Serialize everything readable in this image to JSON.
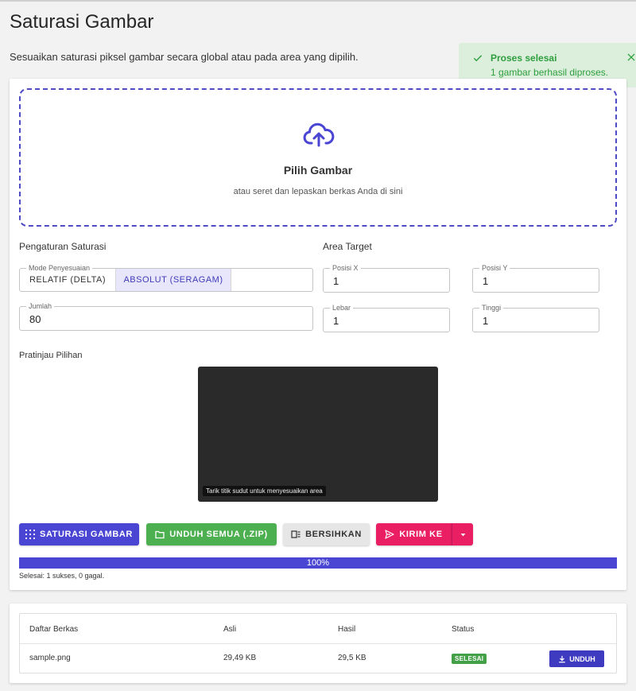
{
  "page": {
    "title": "Saturasi Gambar",
    "description": "Sesuaikan saturasi piksel gambar secara global atau pada area yang dipilih."
  },
  "toast": {
    "title": "Proses selesai",
    "message": "1 gambar berhasil diproses.",
    "color": "#2e9e3e",
    "icons": [
      "check-icon",
      "close-icon"
    ]
  },
  "dropzone": {
    "title": "Pilih Gambar",
    "subtitle": "atau seret dan lepaskan berkas Anda di sini",
    "icon": "cloud-upload-icon",
    "accent": "#4f4bc4"
  },
  "saturation": {
    "section_label": "Pengaturan Saturasi",
    "mode_label": "Mode Penyesuaian",
    "mode_options": [
      "RELATIF (DELTA)",
      "ABSOLUT (SERAGAM)"
    ],
    "mode_selected": "ABSOLUT (SERAGAM)",
    "amount_label": "Jumlah",
    "amount_value": "80"
  },
  "area": {
    "section_label": "Area Target",
    "x_label": "Posisi X",
    "x_value": "1",
    "y_label": "Posisi Y",
    "y_value": "1",
    "width_label": "Lebar",
    "width_value": "1",
    "height_label": "Tinggi",
    "height_value": "1"
  },
  "preview": {
    "label": "Pratinjau Pilihan",
    "hint": "Tarik titik sudut untuk menyesuaikan area"
  },
  "actions": {
    "saturate": "SATURASI GAMBAR",
    "download_all": "UNDUH SEMUA (.ZIP)",
    "clear": "BERSIHKAN",
    "send_to": "KIRIM KE"
  },
  "progress": {
    "percent": 100,
    "label": "100%",
    "summary": "Selesai: 1 sukses, 0 gagal."
  },
  "files": {
    "headers": [
      "Daftar Berkas",
      "Asli",
      "Hasil",
      "Status"
    ],
    "rows": [
      {
        "name": "sample.png",
        "original": "29,49 KB",
        "result": "29,5 KB",
        "status": "SELESAI",
        "action": "UNDUH"
      }
    ]
  },
  "colors": {
    "primary": "#4a45d3",
    "success": "#4caf50",
    "send": "#e91e63"
  }
}
